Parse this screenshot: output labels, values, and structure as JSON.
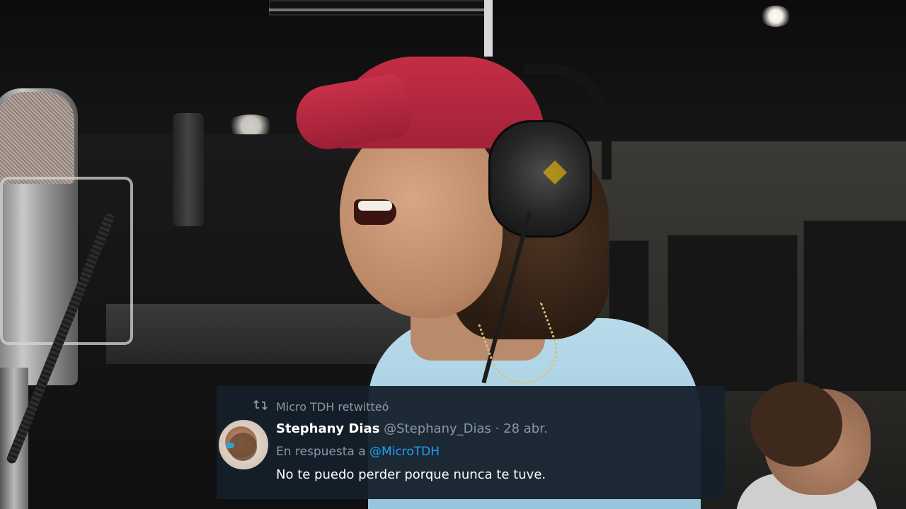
{
  "tweet": {
    "retweeted_by": "Micro TDH retwitteó",
    "display_name": "Stephany Dias",
    "handle": "@Stephany_Dias",
    "separator": "·",
    "date": "28 abr.",
    "reply_prefix": "En respuesta a",
    "reply_to": "@MicroTDH",
    "text": "No te puedo perder porque nunca te tuve."
  },
  "icons": {
    "retweet": "retweet-icon"
  },
  "colors": {
    "overlay_bg": "#15202b",
    "secondary_text": "#8899a6",
    "mention": "#1da1f2",
    "cap": "#c42d45",
    "shirt": "#b9dbeb"
  }
}
